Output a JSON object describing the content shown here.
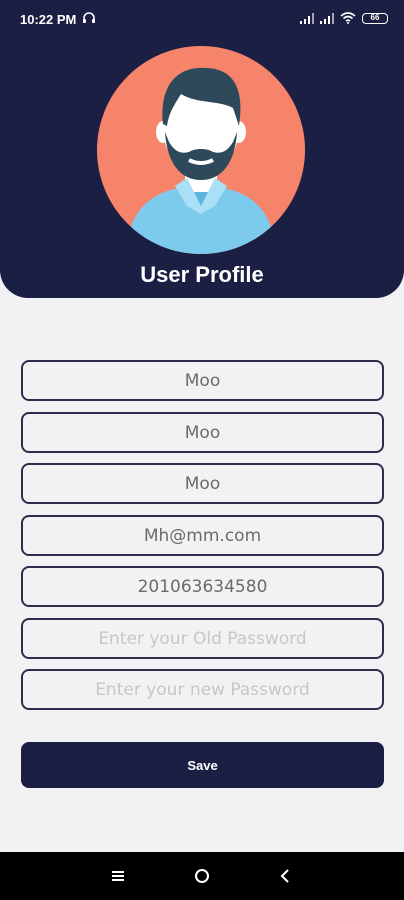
{
  "status_bar": {
    "time": "10:22 PM",
    "battery": "66"
  },
  "header": {
    "title": "User Profile",
    "colors": {
      "background": "#1c1f44",
      "avatar_bg": "#f6846a",
      "shirt": "#7ccbec"
    }
  },
  "form": {
    "first_name": "Moo",
    "middle_name": "Moo",
    "last_name": "Moo",
    "email": "Mh@mm.com",
    "phone": "201063634580",
    "old_password_placeholder": "Enter your Old Password",
    "new_password_placeholder": "Enter your new Password",
    "save_label": "Save"
  },
  "nav_bar": {
    "icons": [
      "menu-icon",
      "home-icon",
      "back-icon"
    ]
  }
}
